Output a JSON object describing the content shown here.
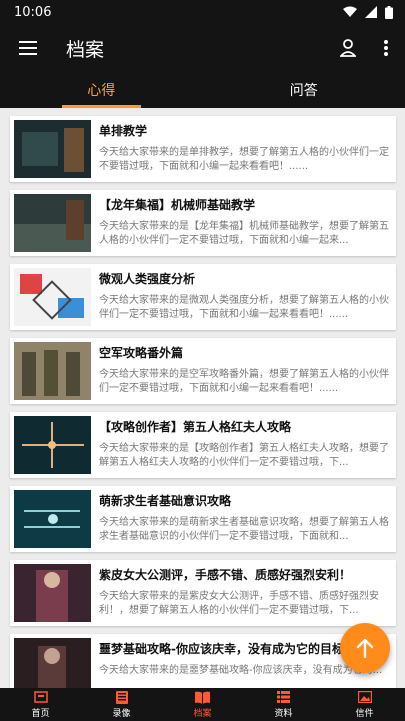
{
  "status_bar": {
    "time": "10:06",
    "icons": [
      "wifi-icon",
      "signal-icon",
      "battery-icon"
    ]
  },
  "app_bar": {
    "title": "档案",
    "icons": [
      "menu-icon",
      "person-icon",
      "more-vert-icon"
    ]
  },
  "tabs": [
    {
      "label": "心得",
      "active": true
    },
    {
      "label": "问答",
      "active": false
    }
  ],
  "articles": [
    {
      "title": "单排教学",
      "desc": "今天给大家带来的是单排教学，想要了解第五人格的小伙伴们一定不要错过哦，下面就和小编一起来看看吧！......"
    },
    {
      "title": "【龙年集福】机械师基础教学",
      "desc": "今天给大家带来的是【龙年集福】机械师基础教学，想要了解第五人格的小伙伴们一定不要错过哦，下面就和小编一起来..."
    },
    {
      "title": "微观人类强度分析",
      "desc": "今天给大家带来的是微观人类强度分析，想要了解第五人格的小伙伴们一定不要错过哦，下面就和小编一起来看看吧！......"
    },
    {
      "title": "空军攻略番外篇",
      "desc": "今天给大家带来的是空军攻略番外篇，想要了解第五人格的小伙伴们一定不要错过哦，下面就和小编一起来看看吧！......"
    },
    {
      "title": "【攻略创作者】第五人格红夫人攻略",
      "desc": "今天给大家带来的是【攻略创作者】第五人格红夫人攻略，想要了解第五人格红夫人攻略的小伙伴们一定不要错过哦，下..."
    },
    {
      "title": "萌新求生者基础意识攻略",
      "desc": "今天给大家带来的是萌新求生者基础意识攻略，想要了解第五人格求生者基础意识的小伙伴们一定不要错过哦，下面就和..."
    },
    {
      "title": "紫皮女大公测评，手感不错、质感好强烈安利！",
      "desc": "今天给大家带来的是紫皮女大公测评，手感不错、质感好强烈安利！，想要了解第五人格的小伙伴们一定不要错过哦，下..."
    },
    {
      "title": "噩梦基础攻略-你应该庆幸，没有成为它的目标",
      "desc": "今天给大家带来的是噩梦基础攻略-你应该庆幸，没有成为它的..."
    }
  ],
  "fab": {
    "icon": "arrow-up-icon"
  },
  "bottom_nav": [
    {
      "label": "首页",
      "icon": "home-icon",
      "active": false
    },
    {
      "label": "录像",
      "icon": "video-icon",
      "active": false
    },
    {
      "label": "档案",
      "icon": "archive-icon",
      "active": true
    },
    {
      "label": "资料",
      "icon": "list-icon",
      "active": false
    },
    {
      "label": "信件",
      "icon": "image-icon",
      "active": false
    }
  ],
  "colors": {
    "accent": "#ff9a2a",
    "fab": "#ff8b1a",
    "nav_active": "#ff5a36",
    "bar_bg": "#141414",
    "list_bg": "#ececec"
  }
}
